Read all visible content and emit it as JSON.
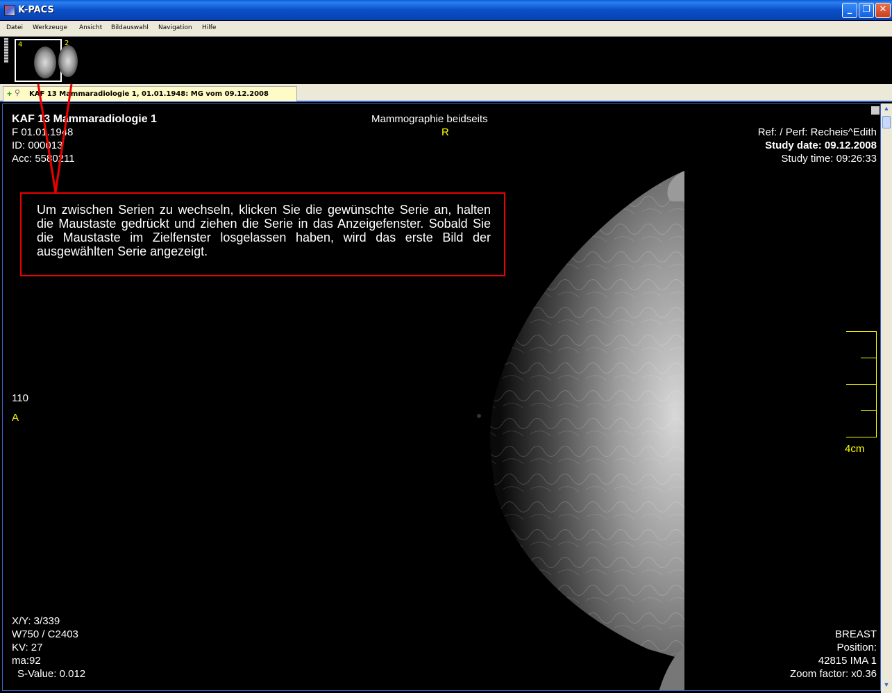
{
  "window": {
    "title": "K-PACS",
    "minimize_glyph": "_",
    "maximize_glyph": "❐",
    "close_glyph": "✕"
  },
  "menu": [
    {
      "label": "Datei"
    },
    {
      "label": "Werkzeuge"
    },
    {
      "label": "Ansicht"
    },
    {
      "label": "Bildauswahl"
    },
    {
      "label": "Navigation"
    },
    {
      "label": "Hilfe"
    }
  ],
  "thumbnails": [
    {
      "series_number": "4",
      "selected": true
    },
    {
      "series_number": "2",
      "selected": false
    }
  ],
  "study_tab": {
    "label": "KAF 13 Mammaradiologie 1, 01.01.1948: MG vom 09.12.2008",
    "icon": "add-search-icon"
  },
  "overlay": {
    "top_left": {
      "patient_name": "KAF 13 Mammaradiologie 1",
      "sex_birthdate": "F 01.01.1948",
      "patient_id": "ID: 000013",
      "accession": "Acc: 5580211"
    },
    "top_center": {
      "study_description": "Mammographie beidseits",
      "orientation": "R"
    },
    "top_right": {
      "referring": "Ref:  / Perf: Recheis^Edith",
      "study_date": "Study date: 09.12.2008",
      "study_time": "Study time: 09:26:33"
    },
    "mid_left": {
      "value": "110",
      "orientation": "A"
    },
    "scale": {
      "label": "4cm",
      "color": "#ffff00"
    },
    "bottom_left": {
      "xy": "X/Y: 3/339",
      "window_center": "W750 / C2403",
      "kv": "KV: 27",
      "ma": "ma:92",
      "s_value": "S-Value: 0.012"
    },
    "bottom_right": {
      "body_part": "BREAST",
      "position": "Position:",
      "image_info": "42815 IMA 1",
      "zoom": "Zoom factor: x0.36"
    }
  },
  "annotation": {
    "text": "Um zwischen Serien zu wechseln, klicken Sie die gewünschte Serie an, halten die Maustaste gedrückt und ziehen die Serie in das Anzeigefenster. Sobald Sie die Maustaste im Zielfenster losgelassen haben, wird das erste Bild der ausgewählten Serie angezeigt.",
    "border_color": "#e00000"
  },
  "colors": {
    "titlebar": "#0a4fc8",
    "menubar": "#ece9d8",
    "tab_background": "#fffbc6",
    "overlay_text": "#ffffff",
    "overlay_accent": "#ffff00"
  }
}
